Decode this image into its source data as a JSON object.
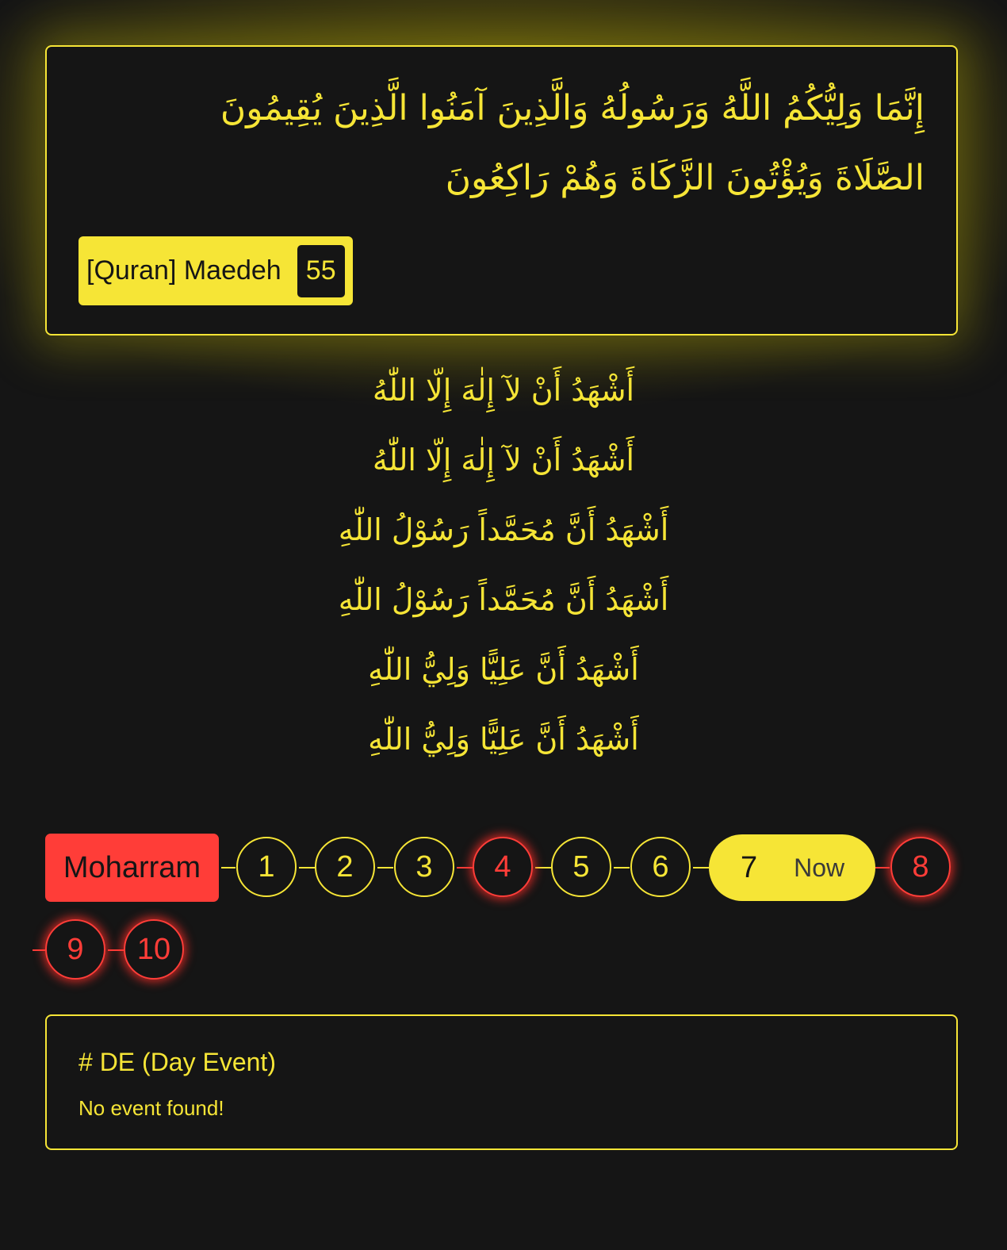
{
  "verse": {
    "lines": [
      "إِنَّمَا وَلِيُّكُمُ اللَّهُ وَرَسُولُهُ وَالَّذِينَ آمَنُوا الَّذِينَ يُقِيمُونَ",
      "الصَّلَاةَ وَيُؤْتُونَ الزَّكَاةَ وَهُمْ رَاكِعُونَ"
    ],
    "source_label": "[Quran] Maedeh",
    "verse_number": "55"
  },
  "azan": {
    "lines": [
      "أَشْهَدُ أَنْ لآ إِلٰهَ إِلّا اللّٰهُ",
      "أَشْهَدُ أَنْ لآ إِلٰهَ إِلّا اللّٰهُ",
      "أَشْهَدُ أَنَّ مُحَمَّداً رَسُوْلُ اللّٰهِ",
      "أَشْهَدُ أَنَّ مُحَمَّداً رَسُوْلُ اللّٰهِ",
      "أَشْهَدُ أَنَّ عَلِيًّا وَلِيُّ اللّٰهِ",
      "أَشْهَدُ أَنَّ عَلِيًّا وَلِيُّ اللّٰهِ"
    ]
  },
  "calendar": {
    "month": "Moharram",
    "now_label": "Now",
    "days": [
      {
        "label": "1",
        "state": "normal"
      },
      {
        "label": "2",
        "state": "normal"
      },
      {
        "label": "3",
        "state": "normal"
      },
      {
        "label": "4",
        "state": "holy"
      },
      {
        "label": "5",
        "state": "normal"
      },
      {
        "label": "6",
        "state": "normal"
      },
      {
        "label": "7",
        "state": "current"
      },
      {
        "label": "8",
        "state": "holy"
      },
      {
        "label": "9",
        "state": "holy"
      },
      {
        "label": "10",
        "state": "holy"
      }
    ]
  },
  "day_event": {
    "title": "# DE (Day Event)",
    "empty_message": "No event found!"
  },
  "colors": {
    "accent": "#f6e536",
    "holy": "#ff3d38",
    "background": "#151515"
  }
}
